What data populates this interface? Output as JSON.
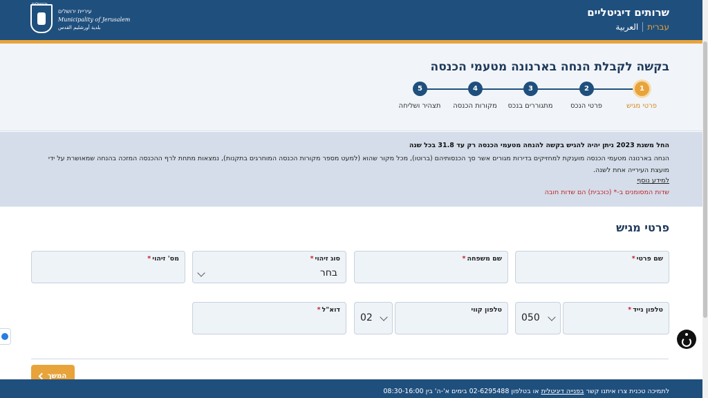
{
  "header": {
    "title": "שרותים דיגיטליים",
    "lang_active": "עברית",
    "lang_other": "العربية",
    "logo": {
      "top": "ירושלים",
      "he": "עיריית ירושלים",
      "en": "Municipality of Jerusalem",
      "ar": "بلدية أورشليم القدس"
    }
  },
  "page_title": "בקשה לקבלת הנחה בארנונה מטעמי הכנסה",
  "steps": [
    {
      "num": "1",
      "label": "פרטי מגיש",
      "active": true
    },
    {
      "num": "2",
      "label": "פרטי הנכס",
      "active": false
    },
    {
      "num": "3",
      "label": "מתגוררים בנכס",
      "active": false
    },
    {
      "num": "4",
      "label": "מקורות הכנסה",
      "active": false
    },
    {
      "num": "5",
      "label": "תצהיר ושליחה",
      "active": false
    }
  ],
  "info": {
    "bold": "החל משנת 2023 ניתן יהיה להגיש בקשה להנחה מטעמי הכנסה רק עד 31.8 בכל שנה",
    "text": "הנחה בארנונה מטעמי הכנסה מוענקת למחזיקים בדירות מגורים אשר סך הכנסותיהם (ברוטו), מכל מקור שהוא (למעט מספר מקורות הכנסה המוחרגים בתקנות), נמצאות מתחת לרף ההכנסה המזכה בהנחה שמאושרת על ידי מועצת העירייה אחת לשנה.",
    "link": "למידע נוסף",
    "required_note": "שדות המסומנים ב-* (כוכבית) הם שדות חובה"
  },
  "form": {
    "section_title": "פרטי מגיש",
    "first_name_label": "שם פרטי",
    "last_name_label": "שם משפחה",
    "id_type_label": "סוג זיהוי",
    "id_type_value": "בחר",
    "id_number_label": "מס' זיהוי",
    "mobile_label": "טלפון נייד",
    "mobile_prefix": "050",
    "landline_label": "טלפון קווי",
    "landline_prefix": "02",
    "email_label": "דוא\"ל",
    "req_mark": "*"
  },
  "next_button": "המשך",
  "footer": {
    "pre": "לתמיכה טכנית צרו איתנו קשר",
    "link": "בפנייה דיגיטלית",
    "post": "או בטלפון 02-6295488 בימים א'-ה' בין 08:30-16:00"
  },
  "colors": {
    "brand_blue": "#1f4f7d",
    "accent_gold": "#e8a33a",
    "required_red": "#c0222a"
  }
}
